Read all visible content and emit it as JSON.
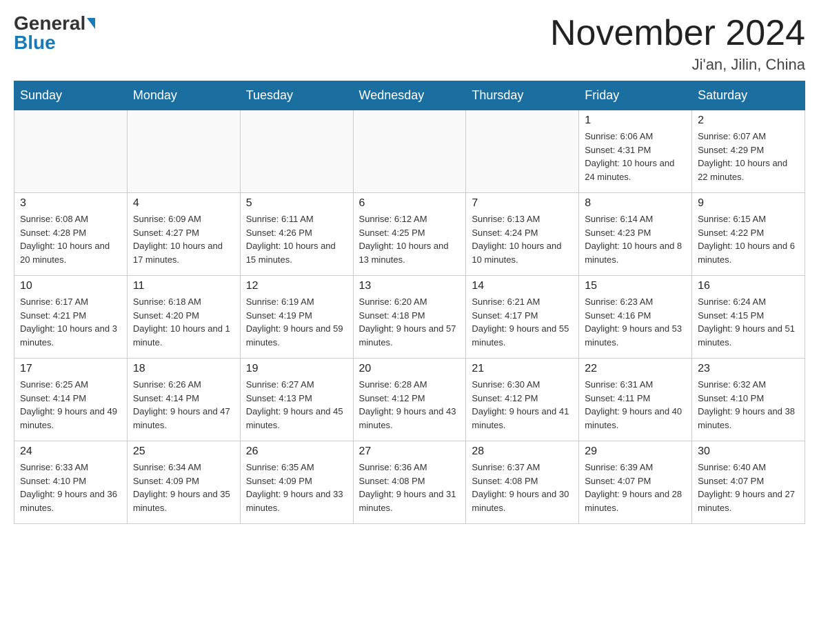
{
  "header": {
    "logo_general": "General",
    "logo_blue": "Blue",
    "month_title": "November 2024",
    "location": "Ji'an, Jilin, China"
  },
  "weekdays": [
    "Sunday",
    "Monday",
    "Tuesday",
    "Wednesday",
    "Thursday",
    "Friday",
    "Saturday"
  ],
  "weeks": [
    [
      {
        "day": "",
        "info": ""
      },
      {
        "day": "",
        "info": ""
      },
      {
        "day": "",
        "info": ""
      },
      {
        "day": "",
        "info": ""
      },
      {
        "day": "",
        "info": ""
      },
      {
        "day": "1",
        "info": "Sunrise: 6:06 AM\nSunset: 4:31 PM\nDaylight: 10 hours and 24 minutes."
      },
      {
        "day": "2",
        "info": "Sunrise: 6:07 AM\nSunset: 4:29 PM\nDaylight: 10 hours and 22 minutes."
      }
    ],
    [
      {
        "day": "3",
        "info": "Sunrise: 6:08 AM\nSunset: 4:28 PM\nDaylight: 10 hours and 20 minutes."
      },
      {
        "day": "4",
        "info": "Sunrise: 6:09 AM\nSunset: 4:27 PM\nDaylight: 10 hours and 17 minutes."
      },
      {
        "day": "5",
        "info": "Sunrise: 6:11 AM\nSunset: 4:26 PM\nDaylight: 10 hours and 15 minutes."
      },
      {
        "day": "6",
        "info": "Sunrise: 6:12 AM\nSunset: 4:25 PM\nDaylight: 10 hours and 13 minutes."
      },
      {
        "day": "7",
        "info": "Sunrise: 6:13 AM\nSunset: 4:24 PM\nDaylight: 10 hours and 10 minutes."
      },
      {
        "day": "8",
        "info": "Sunrise: 6:14 AM\nSunset: 4:23 PM\nDaylight: 10 hours and 8 minutes."
      },
      {
        "day": "9",
        "info": "Sunrise: 6:15 AM\nSunset: 4:22 PM\nDaylight: 10 hours and 6 minutes."
      }
    ],
    [
      {
        "day": "10",
        "info": "Sunrise: 6:17 AM\nSunset: 4:21 PM\nDaylight: 10 hours and 3 minutes."
      },
      {
        "day": "11",
        "info": "Sunrise: 6:18 AM\nSunset: 4:20 PM\nDaylight: 10 hours and 1 minute."
      },
      {
        "day": "12",
        "info": "Sunrise: 6:19 AM\nSunset: 4:19 PM\nDaylight: 9 hours and 59 minutes."
      },
      {
        "day": "13",
        "info": "Sunrise: 6:20 AM\nSunset: 4:18 PM\nDaylight: 9 hours and 57 minutes."
      },
      {
        "day": "14",
        "info": "Sunrise: 6:21 AM\nSunset: 4:17 PM\nDaylight: 9 hours and 55 minutes."
      },
      {
        "day": "15",
        "info": "Sunrise: 6:23 AM\nSunset: 4:16 PM\nDaylight: 9 hours and 53 minutes."
      },
      {
        "day": "16",
        "info": "Sunrise: 6:24 AM\nSunset: 4:15 PM\nDaylight: 9 hours and 51 minutes."
      }
    ],
    [
      {
        "day": "17",
        "info": "Sunrise: 6:25 AM\nSunset: 4:14 PM\nDaylight: 9 hours and 49 minutes."
      },
      {
        "day": "18",
        "info": "Sunrise: 6:26 AM\nSunset: 4:14 PM\nDaylight: 9 hours and 47 minutes."
      },
      {
        "day": "19",
        "info": "Sunrise: 6:27 AM\nSunset: 4:13 PM\nDaylight: 9 hours and 45 minutes."
      },
      {
        "day": "20",
        "info": "Sunrise: 6:28 AM\nSunset: 4:12 PM\nDaylight: 9 hours and 43 minutes."
      },
      {
        "day": "21",
        "info": "Sunrise: 6:30 AM\nSunset: 4:12 PM\nDaylight: 9 hours and 41 minutes."
      },
      {
        "day": "22",
        "info": "Sunrise: 6:31 AM\nSunset: 4:11 PM\nDaylight: 9 hours and 40 minutes."
      },
      {
        "day": "23",
        "info": "Sunrise: 6:32 AM\nSunset: 4:10 PM\nDaylight: 9 hours and 38 minutes."
      }
    ],
    [
      {
        "day": "24",
        "info": "Sunrise: 6:33 AM\nSunset: 4:10 PM\nDaylight: 9 hours and 36 minutes."
      },
      {
        "day": "25",
        "info": "Sunrise: 6:34 AM\nSunset: 4:09 PM\nDaylight: 9 hours and 35 minutes."
      },
      {
        "day": "26",
        "info": "Sunrise: 6:35 AM\nSunset: 4:09 PM\nDaylight: 9 hours and 33 minutes."
      },
      {
        "day": "27",
        "info": "Sunrise: 6:36 AM\nSunset: 4:08 PM\nDaylight: 9 hours and 31 minutes."
      },
      {
        "day": "28",
        "info": "Sunrise: 6:37 AM\nSunset: 4:08 PM\nDaylight: 9 hours and 30 minutes."
      },
      {
        "day": "29",
        "info": "Sunrise: 6:39 AM\nSunset: 4:07 PM\nDaylight: 9 hours and 28 minutes."
      },
      {
        "day": "30",
        "info": "Sunrise: 6:40 AM\nSunset: 4:07 PM\nDaylight: 9 hours and 27 minutes."
      }
    ]
  ]
}
